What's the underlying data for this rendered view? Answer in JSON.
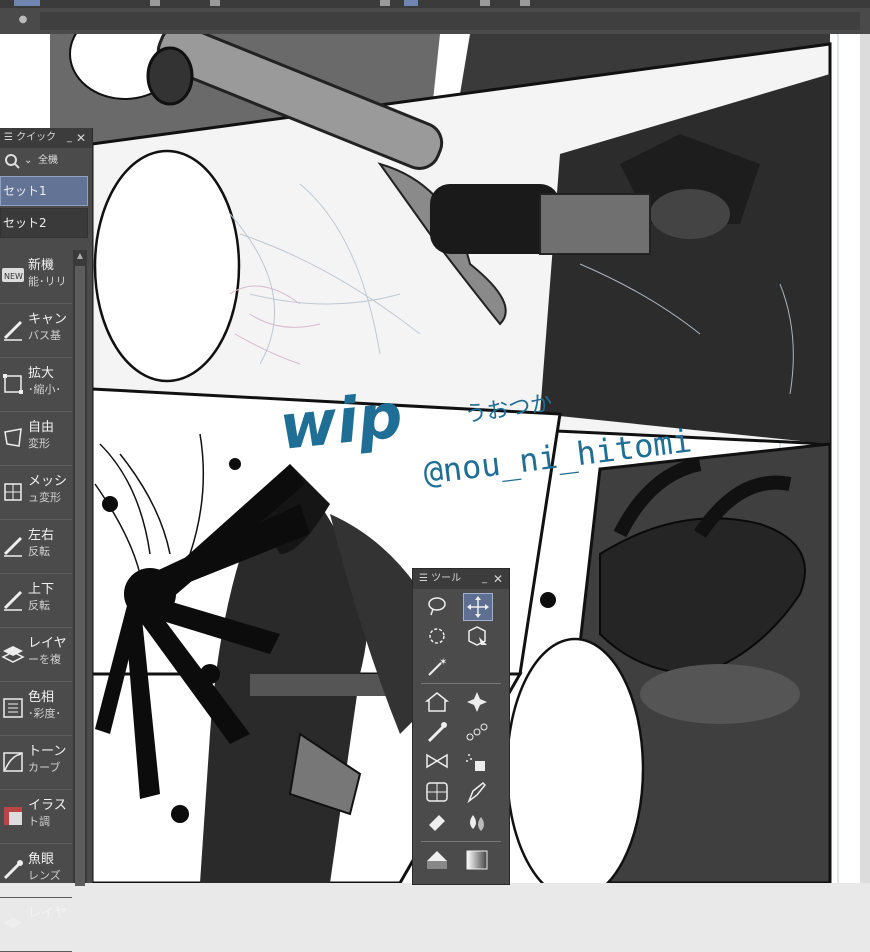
{
  "menubar": {
    "tab_marker": "●"
  },
  "quick_access": {
    "title": "クイック",
    "search_label": "全機",
    "sets": [
      "セット1",
      "セット2"
    ],
    "selected_set": "セット1",
    "items": [
      {
        "l1": "新機",
        "l2": "能･リリ",
        "icon": "new-badge-icon"
      },
      {
        "l1": "キャン",
        "l2": "バス基",
        "icon": "canvas-basic-icon"
      },
      {
        "l1": "拡大",
        "l2": "･縮小･",
        "icon": "scale-icon"
      },
      {
        "l1": "自由",
        "l2": "変形",
        "icon": "free-transform-icon"
      },
      {
        "l1": "メッシ",
        "l2": "ュ変形",
        "icon": "mesh-transform-icon"
      },
      {
        "l1": "左右",
        "l2": "反転",
        "icon": "flip-horizontal-icon"
      },
      {
        "l1": "上下",
        "l2": "反転",
        "icon": "flip-vertical-icon"
      },
      {
        "l1": "レイヤ",
        "l2": "ーを複",
        "icon": "duplicate-layer-icon"
      },
      {
        "l1": "色相",
        "l2": "･彩度･",
        "icon": "hue-saturation-icon"
      },
      {
        "l1": "トーン",
        "l2": "カーブ",
        "icon": "tone-curve-icon"
      },
      {
        "l1": "イラス",
        "l2": "ト調",
        "icon": "illustration-filter-icon"
      },
      {
        "l1": "魚眼",
        "l2": "レンズ",
        "icon": "fisheye-lens-icon"
      },
      {
        "l1": "レイヤ",
        "l2": "",
        "icon": "layer-icon"
      }
    ]
  },
  "tool_palette": {
    "title": "ツール",
    "tools": [
      "lasso-icon",
      "move-icon",
      "rotate-view-icon",
      "object-select-icon",
      "auto-action-icon",
      "house-figure-icon",
      "sparkle-icon",
      "eyedropper-icon",
      "chain-icon",
      "bow-decoration-icon",
      "spray-icon",
      "frame-border-icon",
      "pen-nib-icon",
      "eraser-icon",
      "blend-drops-icon",
      "fill-bucket-icon",
      "gradient-icon"
    ],
    "selected": "move-icon"
  },
  "artwork": {
    "watermark_big": "wip",
    "watermark_jp": "うおつか",
    "watermark_handle": "@nou_ni_hitomi"
  },
  "colors": {
    "panel": "#4b4b4b",
    "selected": "#627396",
    "watermark": "#1f6e95"
  }
}
